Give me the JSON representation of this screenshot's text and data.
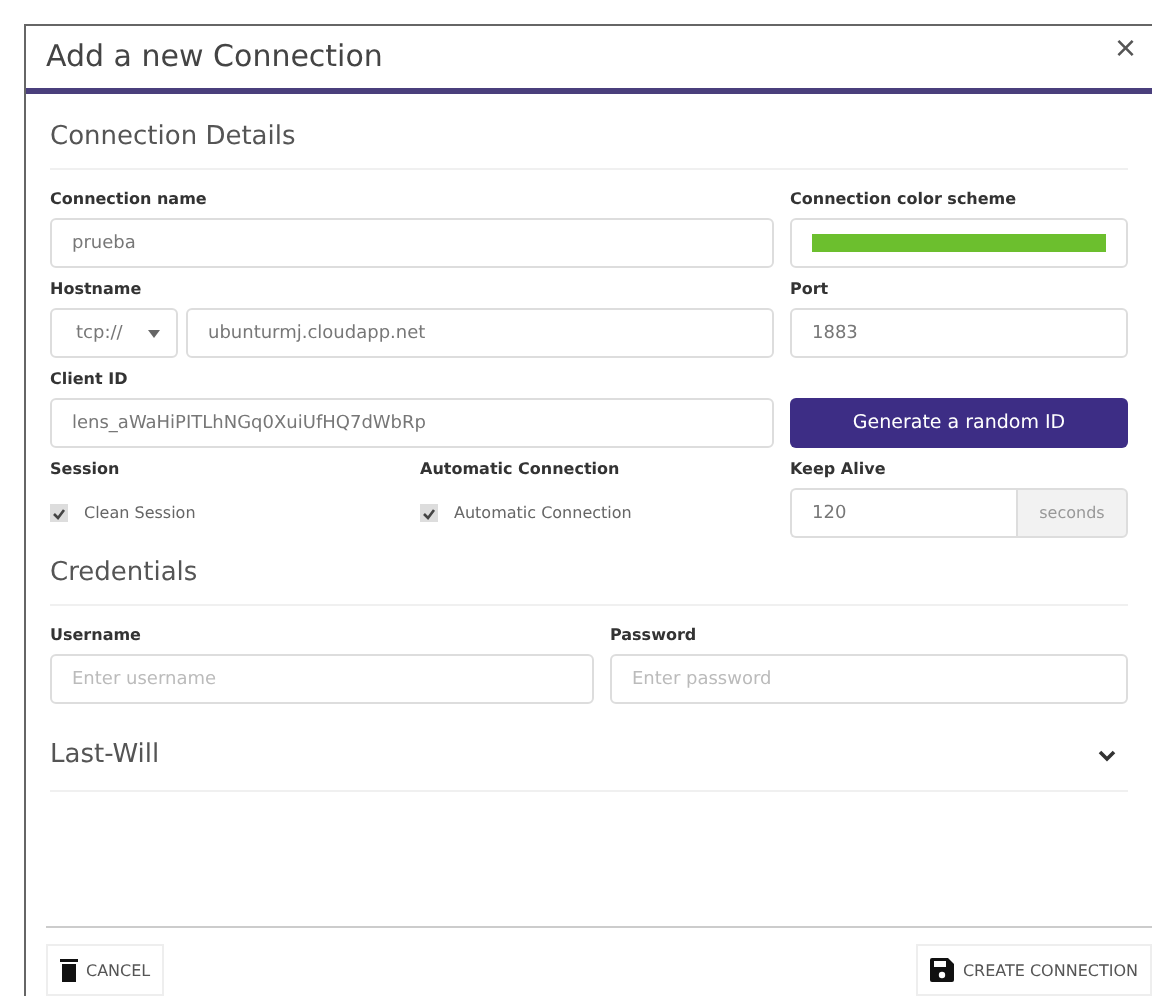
{
  "dialog": {
    "title": "Add a new Connection",
    "close": "×"
  },
  "connection_details": {
    "heading": "Connection Details",
    "connection_name": {
      "label": "Connection name",
      "value": "prueba"
    },
    "color_scheme": {
      "label": "Connection color scheme",
      "color": "#6cbf2e"
    },
    "hostname": {
      "label": "Hostname",
      "protocol": "tcp://",
      "value": "ubunturmj.cloudapp.net"
    },
    "port": {
      "label": "Port",
      "value": "1883"
    },
    "client_id": {
      "label": "Client ID",
      "value": "lens_aWaHiPITLhNGq0XuiUfHQ7dWbRp",
      "button": "Generate a random ID"
    },
    "session": {
      "label": "Session",
      "option": "Clean Session",
      "checked": true
    },
    "automatic_connection": {
      "label": "Automatic Connection",
      "option": "Automatic Connection",
      "checked": true
    },
    "keep_alive": {
      "label": "Keep Alive",
      "value": "120",
      "unit": "seconds"
    }
  },
  "credentials": {
    "heading": "Credentials",
    "username": {
      "label": "Username",
      "placeholder": "Enter username"
    },
    "password": {
      "label": "Password",
      "placeholder": "Enter password"
    }
  },
  "last_will": {
    "heading": "Last-Will",
    "expanded": false
  },
  "footer": {
    "cancel": "CANCEL",
    "create": "CREATE CONNECTION"
  }
}
